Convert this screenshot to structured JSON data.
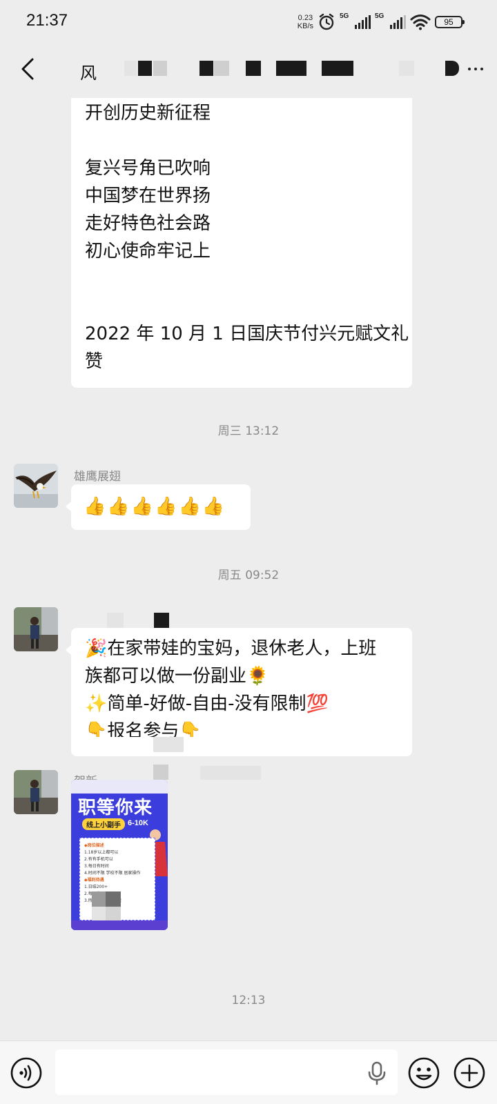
{
  "status_bar": {
    "time": "21:37",
    "net_speed_value": "0.23",
    "net_speed_unit": "KB/s",
    "sim1": "5G",
    "sim2": "5G",
    "battery": "95"
  },
  "header": {
    "title_prefix": "风"
  },
  "messages": {
    "poem_lines": [
      "开创历史新征程",
      "",
      "复兴号角已吹响",
      "中国梦在世界扬",
      "走好特色社会路",
      "初心使命牢记上",
      "",
      "",
      "2022 年 10 月 1 日国庆节付兴元赋文礼",
      "赞"
    ],
    "time_1": "周三 13:12",
    "sender_1": "雄鹰展翅",
    "thumbs": "👍👍👍👍👍👍",
    "time_2": "周五 09:52",
    "ad_lines": [
      "🎉在家带娃的宝妈，退休老人，上班",
      "族都可以做一份副业🌻",
      "✨简单-好做-自由-没有限制💯",
      "👇报名参与👇"
    ],
    "sender_3": "贺新",
    "poster": {
      "headline": "职等你来",
      "subtitle": "线上小副手",
      "salary": "6-10K",
      "section_1": "◆岗位描述",
      "items_1": [
        "1.18岁以上都可以",
        "2.有有手机可以",
        "3.每日有时间",
        "4.时间不限 学校不限 居家操作"
      ],
      "section_2": "◆福利待遇",
      "items_2": [
        "1.日结200+",
        "2.每周结2000+",
        "3.所有工作前有兼职"
      ]
    },
    "time_3": "12:13"
  },
  "input_bar": {
    "placeholder": ""
  },
  "colors": {
    "background": "#ededed",
    "bubble": "#ffffff",
    "poster_blue": "#3b3ddc",
    "poster_yellow": "#ffd23c"
  }
}
